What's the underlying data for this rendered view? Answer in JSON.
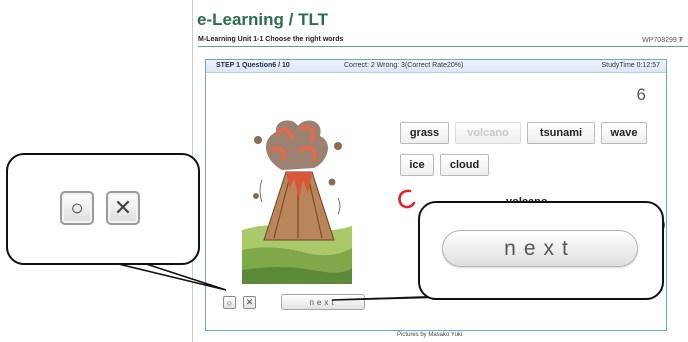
{
  "app": {
    "title": "e-Learning / TLT",
    "subtitle": "M-Learning  Unit 1-1 Choose the right words",
    "code": "WP708299 ₮"
  },
  "status": {
    "question": "STEP 1  Question6 / 10",
    "score": "Correct: 2  Wrong: 3(Correct Rate20%)",
    "study_time": "StudyTime  0:12:57"
  },
  "remaining": "6",
  "words": [
    {
      "label": "grass",
      "state": "available"
    },
    {
      "label": "volcano",
      "state": "used"
    },
    {
      "label": "tsunami",
      "state": "available"
    },
    {
      "label": "wave",
      "state": "available"
    },
    {
      "label": "ice",
      "state": "available"
    },
    {
      "label": "cloud",
      "state": "available"
    }
  ],
  "answer": {
    "word": "volcano",
    "result_icon": "red-circle-correct"
  },
  "controls": {
    "correct_symbol": "○",
    "wrong_symbol": "✕",
    "next_label": "next"
  },
  "callouts": {
    "correct_symbol": "○",
    "wrong_symbol": "✕",
    "next_label": "next"
  },
  "credit": "Pictures by Masako Yuki",
  "colors": {
    "title_green": "#2f6e4a",
    "panel_border": "#6fa5d6",
    "correct_mark": "#d9252a"
  }
}
